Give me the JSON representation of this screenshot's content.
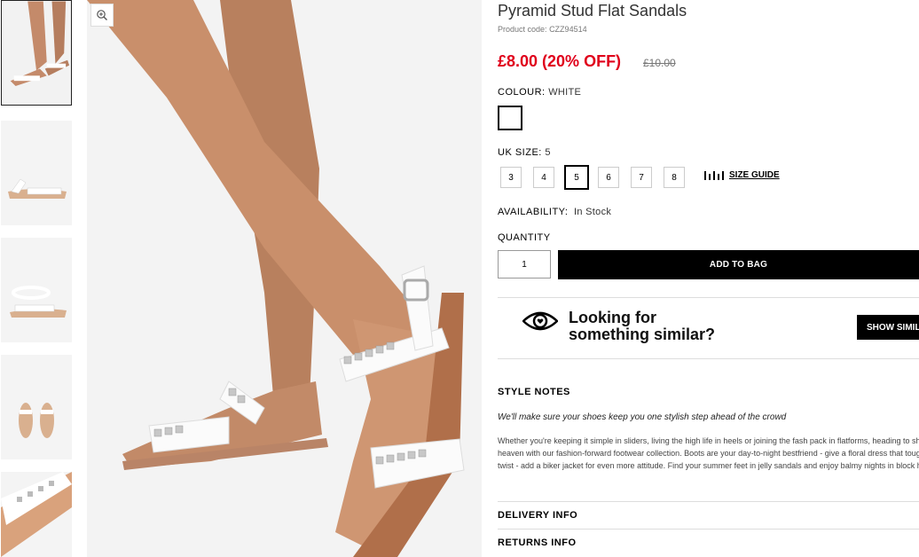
{
  "product": {
    "title": "Pyramid Stud Flat Sandals",
    "code_label": "Product code:",
    "code": "CZZ94514",
    "price": "£8.00 (20% OFF)",
    "old_price": "£10.00"
  },
  "colour": {
    "label": "COLOUR:",
    "value": "WHITE",
    "swatch": "#ffffff"
  },
  "size": {
    "label": "UK SIZE:",
    "value": "5",
    "options": [
      "3",
      "4",
      "5",
      "6",
      "7",
      "8"
    ],
    "guide_label": "SIZE GUIDE"
  },
  "availability": {
    "label": "AVAILABILITY:",
    "value": "In Stock"
  },
  "quantity": {
    "label": "QUANTITY",
    "value": "1"
  },
  "add_to_bag": "ADD TO BAG",
  "similar": {
    "line1": "Looking for",
    "line2": "something similar?",
    "button": "SHOW SIMILAR"
  },
  "style_notes": {
    "heading": "STYLE NOTES",
    "lead": "We'll make sure your shoes keep you one stylish step ahead of the crowd",
    "body": "Whether you're keeping it simple in sliders, living the high life in heels or joining the fash pack in flatforms, heading to shoe heaven with our fashion-forward footwear collection. Boots are your day-to-night bestfriend - give a floral dress that tough twist - add a biker jacket for even more attitude. Find your summer feet in jelly sandals and enjoy balmy nights in block heels."
  },
  "delivery_info": "DELIVERY INFO",
  "returns_info": "RETURNS INFO",
  "icons": {
    "zoom": "zoom-in-icon",
    "eye": "eye-heart-icon",
    "ruler": "ruler-icon"
  },
  "colors": {
    "sale": "#e0001b",
    "button": "#000000"
  }
}
